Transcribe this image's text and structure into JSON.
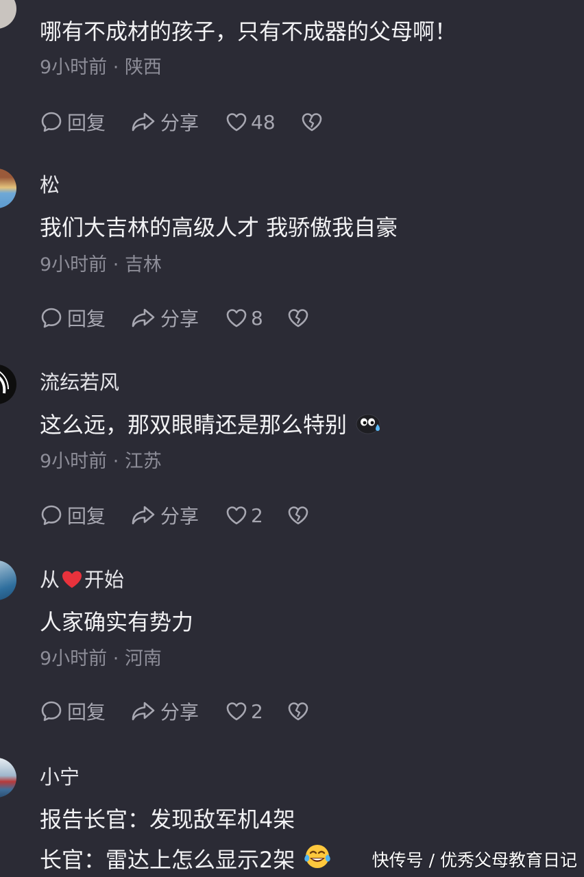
{
  "comments": [
    {
      "username": "",
      "text": "哪有不成材的孩子，只有不成器的父母啊！",
      "time": "9小时前",
      "location": "陕西",
      "reply_label": "回复",
      "share_label": "分享",
      "likes": "48"
    },
    {
      "username": "松",
      "text": "我们大吉林的高级人才 我骄傲我自豪",
      "time": "9小时前",
      "location": "吉林",
      "reply_label": "回复",
      "share_label": "分享",
      "likes": "8"
    },
    {
      "username": "流纭若风",
      "text": "这么远，那双眼睛还是那么特别",
      "time": "9小时前",
      "location": "江苏",
      "reply_label": "回复",
      "share_label": "分享",
      "likes": "2"
    },
    {
      "username_part1": "从",
      "username_part2": "开始",
      "text": "人家确实有势力",
      "time": "9小时前",
      "location": "河南",
      "reply_label": "回复",
      "share_label": "分享",
      "likes": "2"
    },
    {
      "username": "小宁",
      "text_line1": "报告长官：发现敌军机4架",
      "text_line2": "长官：雷达上怎么显示2架"
    }
  ],
  "meta_separator": " · ",
  "icons": {
    "reply": "comment-bubble-icon",
    "share": "share-arrow-icon",
    "like": "heart-outline-icon",
    "dislike": "broken-heart-icon",
    "emoji_peek": "peeking-emoji-icon",
    "emoji_laugh": "tears-of-joy-emoji-icon",
    "heart": "red-heart-emoji-icon"
  },
  "colors": {
    "background": "#2b2b35",
    "text_primary": "#f2f2f4",
    "text_secondary": "#8d8d98",
    "icon": "#a7a7b1",
    "heart_red": "#e8323c"
  },
  "watermark": "快传号 / 优秀父母教育日记"
}
